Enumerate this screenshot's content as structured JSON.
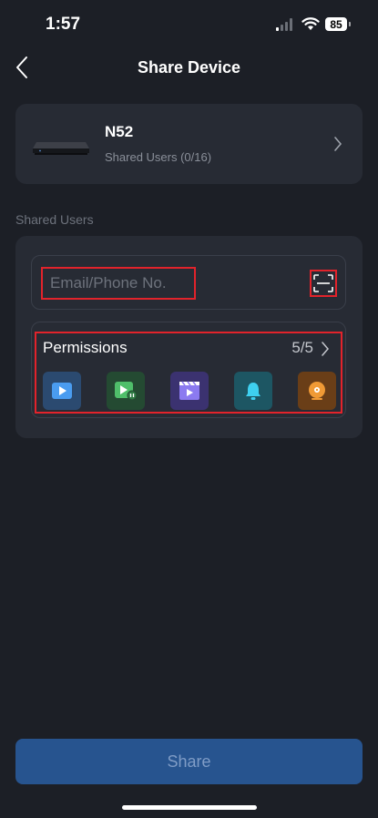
{
  "status": {
    "time": "1:57",
    "battery": "85"
  },
  "nav": {
    "title": "Share Device"
  },
  "device": {
    "name": "N52",
    "shared_users": "Shared Users (0/16)"
  },
  "section_label": "Shared Users",
  "email": {
    "placeholder": "Email/Phone No.",
    "value": ""
  },
  "permissions": {
    "label": "Permissions",
    "count": "5/5",
    "icons": [
      "live-view-icon",
      "playback-icon",
      "video-clip-icon",
      "notification-bell-icon",
      "storage-disk-icon"
    ]
  },
  "share_button": {
    "label": "Share"
  },
  "colors": {
    "accent_red": "#e2232b",
    "button_blue": "#27548f",
    "background": "#1c1f26",
    "card": "#272b34"
  }
}
